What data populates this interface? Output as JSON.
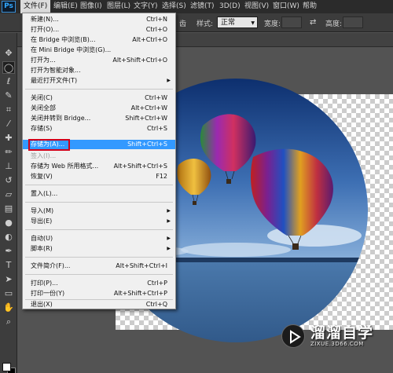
{
  "app": {
    "logo": "Ps"
  },
  "menubar": {
    "items": [
      {
        "label": "文件(F)",
        "active": true
      },
      {
        "label": "编辑(E)"
      },
      {
        "label": "图像(I)"
      },
      {
        "label": "图层(L)"
      },
      {
        "label": "文字(Y)"
      },
      {
        "label": "选择(S)"
      },
      {
        "label": "滤镜(T)"
      },
      {
        "label": "3D(D)"
      },
      {
        "label": "视图(V)"
      },
      {
        "label": "窗口(W)"
      },
      {
        "label": "帮助"
      }
    ]
  },
  "options": {
    "partial_label": "齿",
    "style_label": "样式:",
    "style_value": "正常",
    "width_label": "宽度:",
    "height_label": "高度:"
  },
  "file_menu": {
    "items": [
      {
        "label": "新建(N)...",
        "shortcut": "Ctrl+N"
      },
      {
        "label": "打开(O)...",
        "shortcut": "Ctrl+O"
      },
      {
        "label": "在 Bridge 中浏览(B)...",
        "shortcut": "Alt+Ctrl+O"
      },
      {
        "label": "在 Mini Bridge 中浏览(G)...",
        "shortcut": ""
      },
      {
        "label": "打开为...",
        "shortcut": "Alt+Shift+Ctrl+O"
      },
      {
        "label": "打开为智能对象...",
        "shortcut": ""
      },
      {
        "label": "最近打开文件(T)",
        "shortcut": "",
        "submenu": true
      },
      {
        "label": "关闭(C)",
        "shortcut": "Ctrl+W"
      },
      {
        "label": "关闭全部",
        "shortcut": "Alt+Ctrl+W"
      },
      {
        "label": "关闭并转到 Bridge...",
        "shortcut": "Shift+Ctrl+W"
      },
      {
        "label": "存储(S)",
        "shortcut": "Ctrl+S"
      },
      {
        "label": "存储为(A)...",
        "shortcut": "Shift+Ctrl+S",
        "highlighted": true
      },
      {
        "label": "签入(I)...",
        "shortcut": "",
        "disabled": true
      },
      {
        "label": "存储为 Web 所用格式...",
        "shortcut": "Alt+Shift+Ctrl+S"
      },
      {
        "label": "恢复(V)",
        "shortcut": "F12"
      },
      {
        "label": "置入(L)...",
        "shortcut": ""
      },
      {
        "label": "导入(M)",
        "shortcut": "",
        "submenu": true
      },
      {
        "label": "导出(E)",
        "shortcut": "",
        "submenu": true
      },
      {
        "label": "自动(U)",
        "shortcut": "",
        "submenu": true
      },
      {
        "label": "脚本(R)",
        "shortcut": "",
        "submenu": true
      },
      {
        "label": "文件简介(F)...",
        "shortcut": "Alt+Shift+Ctrl+I"
      },
      {
        "label": "打印(P)...",
        "shortcut": "Ctrl+P"
      },
      {
        "label": "打印一份(Y)",
        "shortcut": "Alt+Shift+Ctrl+P"
      },
      {
        "label": "退出(X)",
        "shortcut": "Ctrl+Q"
      }
    ]
  },
  "watermark": {
    "title": "溜溜自学",
    "subtitle": "ZIXUE.3D66.COM"
  },
  "colors": {
    "menu_highlight": "#3399ff",
    "annotation_box": "#d0021b",
    "sky_top": "#0d2f6e",
    "sky_bottom": "#6e9ed4",
    "sea": "#3e6a9e"
  },
  "icons": {
    "arrow": "▸",
    "tools": [
      "move-tool-icon",
      "marquee-tool-icon",
      "lasso-tool-icon",
      "quick-select-tool-icon",
      "crop-tool-icon",
      "eyedropper-tool-icon",
      "healing-brush-icon",
      "brush-tool-icon",
      "clone-stamp-icon",
      "history-brush-icon",
      "eraser-tool-icon",
      "gradient-tool-icon",
      "blur-tool-icon",
      "dodge-tool-icon",
      "pen-tool-icon",
      "type-tool-icon",
      "path-select-icon",
      "shape-tool-icon",
      "hand-tool-icon",
      "zoom-tool-icon"
    ]
  }
}
